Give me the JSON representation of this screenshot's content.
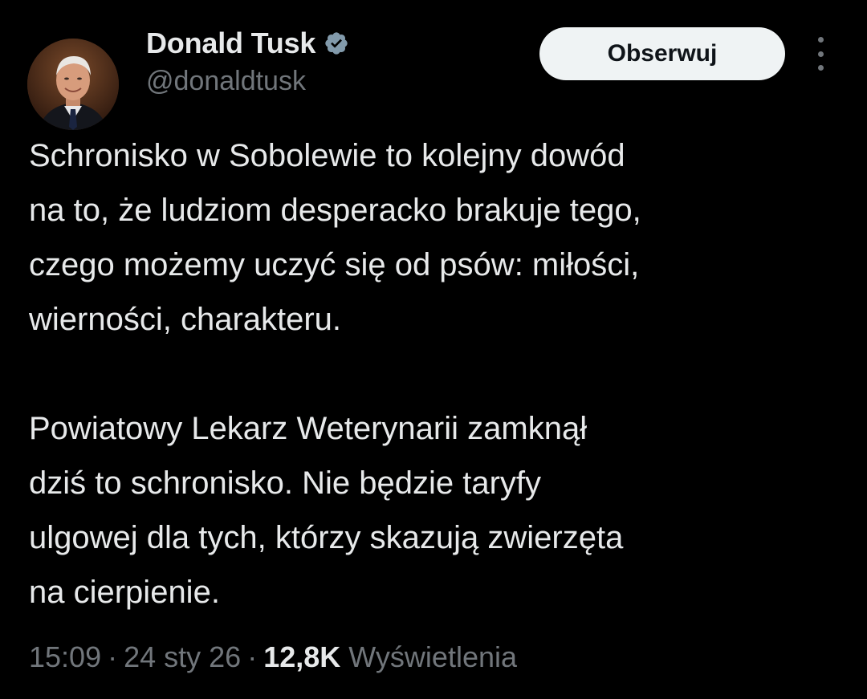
{
  "author": {
    "display_name": "Donald Tusk",
    "handle": "@donaldtusk",
    "verified_icon": "verified-badge-icon",
    "verified_color": "#829aab"
  },
  "header": {
    "follow_label": "Obserwuj",
    "more_icon": "more-vertical-icon"
  },
  "tweet": {
    "paragraph_1": "Schronisko w Sobolewie to kolejny dowód\nna to, że ludziom desperacko brakuje tego,\nczego możemy uczyć się od psów: miłości,\nwierności, charakteru.",
    "paragraph_2": "Powiatowy Lekarz Weterynarii zamknął\ndziś to schronisko. Nie będzie taryfy\nulgowej dla tych, którzy skazują zwierzęta\nna cierpienie."
  },
  "meta": {
    "time": "15:09",
    "separator": "·",
    "date": "24 sty 26",
    "views_count": "12,8K",
    "views_label": "Wyświetlenia"
  },
  "colors": {
    "background": "#000000",
    "text_primary": "#e7e9ea",
    "text_secondary": "#71767b",
    "button_bg": "#eff3f4"
  }
}
